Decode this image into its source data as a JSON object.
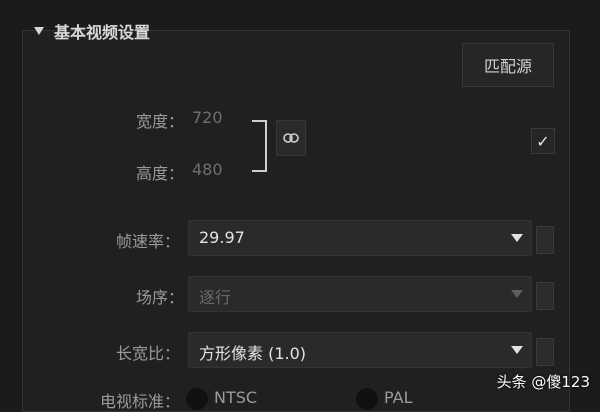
{
  "section": {
    "title": "基本视频设置"
  },
  "match_button": {
    "label": "匹配源"
  },
  "width": {
    "label": "宽度：",
    "value": "720"
  },
  "height": {
    "label": "高度：",
    "value": "480"
  },
  "checkbox": {
    "mark": "✓"
  },
  "frame_rate": {
    "label": "帧速率：",
    "value": "29.97"
  },
  "field_order": {
    "label": "场序：",
    "value": "逐行"
  },
  "aspect_ratio": {
    "label": "长宽比：",
    "value": "方形像素 (1.0)"
  },
  "tv_standard": {
    "label": "电视标准：",
    "opt1": "NTSC",
    "opt2": "PAL"
  },
  "watermark": {
    "text": "头条 @傻123"
  }
}
